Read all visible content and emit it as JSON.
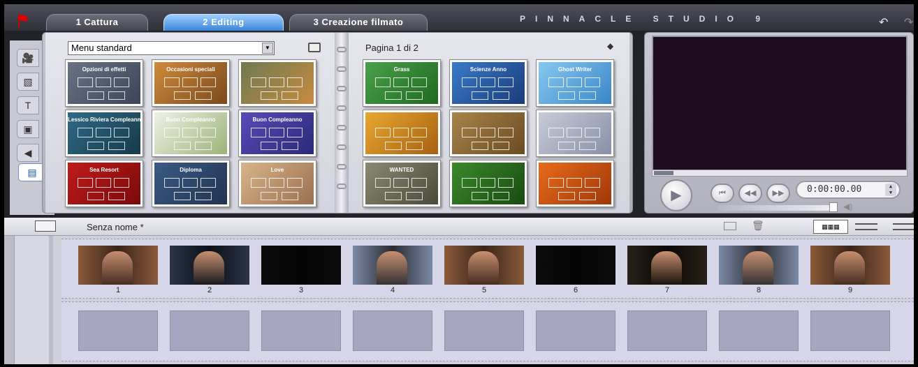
{
  "header": {
    "tabs": [
      {
        "label": "1 Cattura"
      },
      {
        "label": "2 Editing",
        "active": true
      },
      {
        "label": "3 Creazione filmato"
      }
    ],
    "brand": "PINNACLE STUDIO 9",
    "accent_color": "#3b84d8"
  },
  "side_tools": [
    {
      "icon": "video-camera-icon"
    },
    {
      "icon": "transitions-icon"
    },
    {
      "icon": "titles-icon"
    },
    {
      "icon": "photo-icon"
    },
    {
      "icon": "audio-icon"
    },
    {
      "icon": "disc-menu-icon",
      "active": true
    }
  ],
  "album": {
    "menu_select": "Menu standard",
    "page_label": "Pagina 1 di 2",
    "left_thumbs": [
      {
        "caption": "Opzioni di effetti",
        "colors": [
          "#6a7286",
          "#3c4458"
        ]
      },
      {
        "caption": "Occasioni speciali",
        "colors": [
          "#d08a3c",
          "#7a4a1c"
        ]
      },
      {
        "caption": "",
        "colors": [
          "#6e7a52",
          "#c88a40"
        ]
      },
      {
        "caption": "Lessico Riviera Compleanno",
        "colors": [
          "#2f6a86",
          "#163a4a"
        ]
      },
      {
        "caption": "Buon Compleanno",
        "colors": [
          "#eef2e4",
          "#9cb27a"
        ]
      },
      {
        "caption": "Buon Compleanno",
        "colors": [
          "#5a4ab8",
          "#2a2a7a"
        ]
      },
      {
        "caption": "Sea Resort",
        "colors": [
          "#c01a1a",
          "#7a0a0a"
        ]
      },
      {
        "caption": "Diploma",
        "colors": [
          "#3a5a86",
          "#22344e"
        ]
      },
      {
        "caption": "Love",
        "colors": [
          "#d8b48a",
          "#9a7050"
        ]
      }
    ],
    "right_thumbs": [
      {
        "caption": "Grass",
        "colors": [
          "#4aa04a",
          "#1f6a22"
        ]
      },
      {
        "caption": "Scienze Anno",
        "colors": [
          "#3a7ac8",
          "#1a3c7a"
        ]
      },
      {
        "caption": "Ghost Writer",
        "colors": [
          "#88c8f0",
          "#3a86c8"
        ]
      },
      {
        "caption": "",
        "colors": [
          "#e8a830",
          "#a86010"
        ]
      },
      {
        "caption": "",
        "colors": [
          "#a8844a",
          "#6a4c20"
        ]
      },
      {
        "caption": "",
        "colors": [
          "#c8ccd8",
          "#8890a8"
        ]
      },
      {
        "caption": "WANTED",
        "colors": [
          "#8a8a72",
          "#4a4a3a"
        ]
      },
      {
        "caption": "",
        "colors": [
          "#3a8a2a",
          "#1a4a12"
        ]
      },
      {
        "caption": "",
        "colors": [
          "#e86a1a",
          "#a0380a"
        ]
      }
    ]
  },
  "player": {
    "timecode": "0:00:00.00"
  },
  "storyboard": {
    "title": "Senza nome *",
    "clips": [
      {
        "number": "1",
        "tone": [
          "#8a5a3a",
          "#3a2418"
        ]
      },
      {
        "number": "2",
        "tone": [
          "#2a3446",
          "#0c1018"
        ]
      },
      {
        "number": "3",
        "tone": [
          "#0c0c0c",
          "#040404"
        ]
      },
      {
        "number": "4",
        "tone": [
          "#7a8aa6",
          "#2a2a30"
        ]
      },
      {
        "number": "5",
        "tone": [
          "#8a5a3a",
          "#3a2418"
        ]
      },
      {
        "number": "6",
        "tone": [
          "#0c0c0c",
          "#040404"
        ]
      },
      {
        "number": "7",
        "tone": [
          "#2a2018",
          "#0a0806"
        ]
      },
      {
        "number": "8",
        "tone": [
          "#7a8aa6",
          "#2a2a30"
        ]
      },
      {
        "number": "9",
        "tone": [
          "#8a5a3a",
          "#3a2418"
        ]
      }
    ],
    "empty_slots": 9
  }
}
